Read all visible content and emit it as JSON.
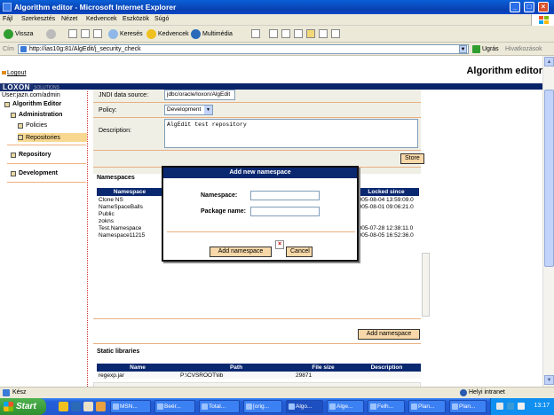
{
  "window": {
    "title": "Algorithm editor - Microsoft Internet Explorer"
  },
  "menu": [
    "Fájl",
    "Szerkesztés",
    "Nézet",
    "Kedvencek",
    "Eszközök",
    "Súgó"
  ],
  "toolbar": {
    "back": "Vissza",
    "search": "Keresés",
    "favorites": "Kedvencek",
    "media": "Multimédia"
  },
  "address": {
    "label": "Cím",
    "url": "http://ias10g:81/AlgEdit/j_security_check",
    "go": "Ugrás",
    "links": "Hivatkozások"
  },
  "page": {
    "logout": "Logout",
    "title": "Algorithm editor",
    "brand": "LOXON",
    "brand_sub": "SOLUTIONS",
    "user": "User:jazn.com/admin"
  },
  "sidebar": {
    "root": "Algorithm Editor",
    "administration": "Administration",
    "policies": "Policies",
    "repositories": "Repositories",
    "repository": "Repository",
    "development": "Development"
  },
  "form": {
    "jndi_label": "JNDI data source:",
    "jndi_value": "jdbc/oracle/loxon/AlgEdit",
    "policy_label": "Policy:",
    "policy_value": "Development",
    "description_label": "Description:",
    "description_value": "AlgEdit test repository",
    "store": "Store"
  },
  "namespaces": {
    "title": "Namespaces",
    "headers": [
      "Namespace",
      "Locked since"
    ],
    "rows": [
      {
        "name": "Clone NS",
        "locked": "2005-08-04 13:59:09.0"
      },
      {
        "name": "NameSpaceBalls",
        "locked": "2005-08-01 09:06:21.0"
      },
      {
        "name": "Public",
        "locked": ""
      },
      {
        "name": "zokns",
        "locked": ""
      },
      {
        "name": "Test.Namespace",
        "locked": "2005-07-28 12:38:11.0"
      },
      {
        "name": "Namespace11215",
        "locked": "2005-08-05 16:52:36.0"
      }
    ],
    "add_button": "Add namespace"
  },
  "static_libraries": {
    "title": "Static libraries",
    "headers": [
      "Name",
      "Path",
      "File size",
      "Description"
    ],
    "rows": [
      {
        "name": "regexp.jar",
        "path": "P:\\CVSROOT\\lib",
        "size": "29871",
        "description": ""
      }
    ]
  },
  "dialog": {
    "title": "Add new namespace",
    "namespace_label": "Namespace:",
    "package_label": "Package name:",
    "add": "Add namespace",
    "cancel": "Cancel"
  },
  "status": {
    "text": "Kész",
    "zone": "Helyi intranet"
  },
  "taskbar": {
    "start": "Start",
    "tasks": [
      "MSN...",
      "Beér...",
      "Total...",
      "[orig...",
      "Algo...",
      "Alge...",
      "Felh...",
      "Plan...",
      "Plan..."
    ],
    "active_index": 4,
    "clock": "13:17"
  },
  "colors": {
    "header_blue": "#0a2870",
    "button_bg": "#f8d8a8",
    "separator": "#e8b080"
  }
}
